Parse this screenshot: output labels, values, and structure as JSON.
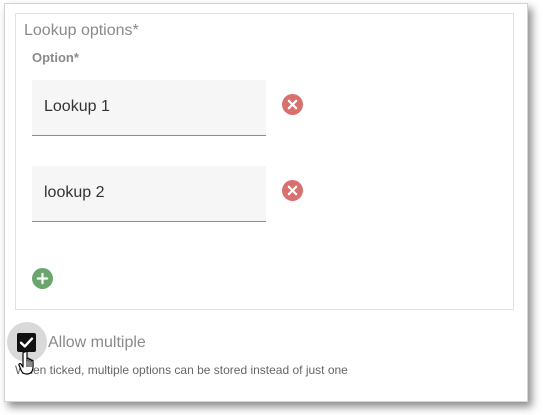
{
  "lookup_options": {
    "legend": "Lookup options*",
    "option_label": "Option*",
    "options": [
      {
        "value": "Lookup 1",
        "remove_icon": "remove-circle-icon"
      },
      {
        "value": "lookup 2",
        "remove_icon": "remove-circle-icon"
      }
    ],
    "add_icon": "add-circle-icon"
  },
  "allow_multiple": {
    "label": "Allow multiple",
    "checked": true,
    "helper_text": "When ticked, multiple options can be stored instead of just one"
  },
  "colors": {
    "remove": "#d97070",
    "add": "#6aa56e",
    "checkbox": "#111111"
  }
}
